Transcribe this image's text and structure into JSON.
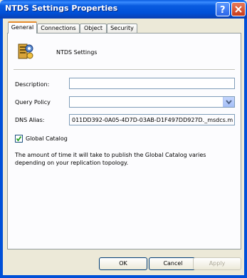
{
  "window": {
    "title": "NTDS Settings Properties"
  },
  "tabs": [
    {
      "label": "General",
      "active": true
    },
    {
      "label": "Connections",
      "active": false
    },
    {
      "label": "Object",
      "active": false
    },
    {
      "label": "Security",
      "active": false
    }
  ],
  "general": {
    "object_name": "NTDS Settings",
    "description_label": "Description:",
    "description_value": "",
    "query_policy_label": "Query Policy",
    "query_policy_value": "",
    "dns_alias_label": "DNS Alias:",
    "dns_alias_value": "011DD392-0A05-4D7D-03AB-D1F497DD927D._msdcs.m",
    "global_catalog_label": "Global Catalog",
    "global_catalog_checked": true,
    "info_text": "The amount of time it will take to publish the Global Catalog varies depending on your replication topology."
  },
  "buttons": {
    "ok": "OK",
    "cancel": "Cancel",
    "apply": "Apply"
  }
}
